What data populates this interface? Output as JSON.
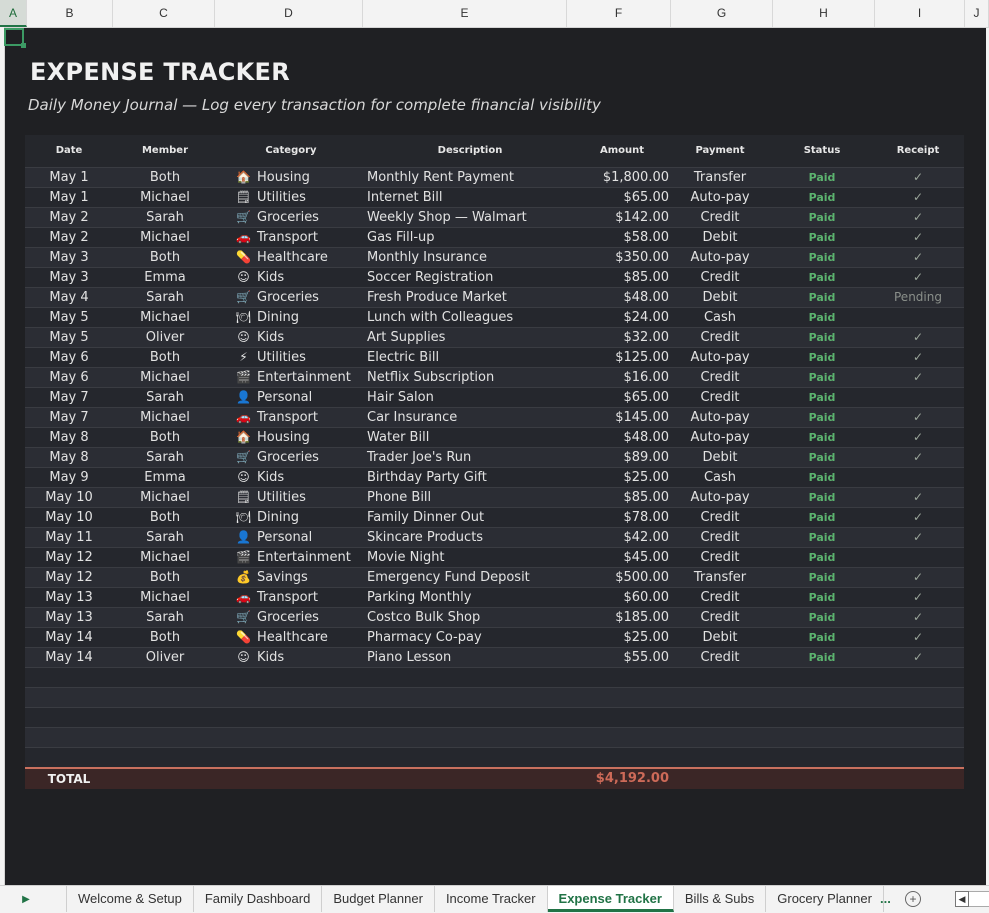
{
  "columns": [
    "A",
    "B",
    "C",
    "D",
    "E",
    "F",
    "G",
    "H",
    "I",
    "J"
  ],
  "title": "EXPENSE TRACKER",
  "subtitle": "Daily Money Journal — Log every transaction for complete financial visibility",
  "headers": {
    "date": "Date",
    "member": "Member",
    "category": "Category",
    "description": "Description",
    "amount": "Amount",
    "payment": "Payment",
    "status": "Status",
    "receipt": "Receipt"
  },
  "rows": [
    {
      "date": "May 1",
      "member": "Both",
      "icon": "house-icon",
      "glyph": "🏠",
      "category": "Housing",
      "description": "Monthly Rent Payment",
      "amount": "$1,800.00",
      "payment": "Transfer",
      "status": "Paid",
      "receipt": "✓"
    },
    {
      "date": "May 1",
      "member": "Michael",
      "icon": "bill-icon",
      "glyph": "🗒",
      "category": "Utilities",
      "description": "Internet Bill",
      "amount": "$65.00",
      "payment": "Auto-pay",
      "status": "Paid",
      "receipt": "✓"
    },
    {
      "date": "May 2",
      "member": "Sarah",
      "icon": "cart-icon",
      "glyph": "🛒",
      "category": "Groceries",
      "description": "Weekly Shop — Walmart",
      "amount": "$142.00",
      "payment": "Credit",
      "status": "Paid",
      "receipt": "✓"
    },
    {
      "date": "May 2",
      "member": "Michael",
      "icon": "car-icon",
      "glyph": "🚗",
      "category": "Transport",
      "description": "Gas Fill-up",
      "amount": "$58.00",
      "payment": "Debit",
      "status": "Paid",
      "receipt": "✓"
    },
    {
      "date": "May 3",
      "member": "Both",
      "icon": "pill-icon",
      "glyph": "💊",
      "category": "Healthcare",
      "description": "Monthly Insurance",
      "amount": "$350.00",
      "payment": "Auto-pay",
      "status": "Paid",
      "receipt": "✓"
    },
    {
      "date": "May 3",
      "member": "Emma",
      "icon": "baby-icon",
      "glyph": "☺",
      "category": "Kids",
      "description": "Soccer Registration",
      "amount": "$85.00",
      "payment": "Credit",
      "status": "Paid",
      "receipt": "✓"
    },
    {
      "date": "May 4",
      "member": "Sarah",
      "icon": "cart-icon",
      "glyph": "🛒",
      "category": "Groceries",
      "description": "Fresh Produce Market",
      "amount": "$48.00",
      "payment": "Debit",
      "status": "Paid",
      "receipt": "Pending"
    },
    {
      "date": "May 5",
      "member": "Michael",
      "icon": "plate-icon",
      "glyph": "🍽",
      "category": "Dining",
      "description": "Lunch with Colleagues",
      "amount": "$24.00",
      "payment": "Cash",
      "status": "Paid",
      "receipt": ""
    },
    {
      "date": "May 5",
      "member": "Oliver",
      "icon": "baby-icon",
      "glyph": "☺",
      "category": "Kids",
      "description": "Art Supplies",
      "amount": "$32.00",
      "payment": "Credit",
      "status": "Paid",
      "receipt": "✓"
    },
    {
      "date": "May 6",
      "member": "Both",
      "icon": "lightning-icon",
      "glyph": "⚡",
      "category": "Utilities",
      "description": "Electric Bill",
      "amount": "$125.00",
      "payment": "Auto-pay",
      "status": "Paid",
      "receipt": "✓"
    },
    {
      "date": "May 6",
      "member": "Michael",
      "icon": "clapper-icon",
      "glyph": "🎬",
      "category": "Entertainment",
      "description": "Netflix Subscription",
      "amount": "$16.00",
      "payment": "Credit",
      "status": "Paid",
      "receipt": "✓"
    },
    {
      "date": "May 7",
      "member": "Sarah",
      "icon": "person-icon",
      "glyph": "👤",
      "category": "Personal",
      "description": "Hair Salon",
      "amount": "$65.00",
      "payment": "Credit",
      "status": "Paid",
      "receipt": ""
    },
    {
      "date": "May 7",
      "member": "Michael",
      "icon": "car-icon",
      "glyph": "🚗",
      "category": "Transport",
      "description": "Car Insurance",
      "amount": "$145.00",
      "payment": "Auto-pay",
      "status": "Paid",
      "receipt": "✓"
    },
    {
      "date": "May 8",
      "member": "Both",
      "icon": "house-icon",
      "glyph": "🏠",
      "category": "Housing",
      "description": "Water Bill",
      "amount": "$48.00",
      "payment": "Auto-pay",
      "status": "Paid",
      "receipt": "✓"
    },
    {
      "date": "May 8",
      "member": "Sarah",
      "icon": "cart-icon",
      "glyph": "🛒",
      "category": "Groceries",
      "description": "Trader Joe's Run",
      "amount": "$89.00",
      "payment": "Debit",
      "status": "Paid",
      "receipt": "✓"
    },
    {
      "date": "May 9",
      "member": "Emma",
      "icon": "baby-icon",
      "glyph": "☺",
      "category": "Kids",
      "description": "Birthday Party Gift",
      "amount": "$25.00",
      "payment": "Cash",
      "status": "Paid",
      "receipt": ""
    },
    {
      "date": "May 10",
      "member": "Michael",
      "icon": "bill-icon",
      "glyph": "🗒",
      "category": "Utilities",
      "description": "Phone Bill",
      "amount": "$85.00",
      "payment": "Auto-pay",
      "status": "Paid",
      "receipt": "✓"
    },
    {
      "date": "May 10",
      "member": "Both",
      "icon": "plate-icon",
      "glyph": "🍽",
      "category": "Dining",
      "description": "Family Dinner Out",
      "amount": "$78.00",
      "payment": "Credit",
      "status": "Paid",
      "receipt": "✓"
    },
    {
      "date": "May 11",
      "member": "Sarah",
      "icon": "person-icon",
      "glyph": "👤",
      "category": "Personal",
      "description": "Skincare Products",
      "amount": "$42.00",
      "payment": "Credit",
      "status": "Paid",
      "receipt": "✓"
    },
    {
      "date": "May 12",
      "member": "Michael",
      "icon": "clapper-icon",
      "glyph": "🎬",
      "category": "Entertainment",
      "description": "Movie Night",
      "amount": "$45.00",
      "payment": "Credit",
      "status": "Paid",
      "receipt": ""
    },
    {
      "date": "May 12",
      "member": "Both",
      "icon": "money-bag-icon",
      "glyph": "💰",
      "category": "Savings",
      "description": "Emergency Fund Deposit",
      "amount": "$500.00",
      "payment": "Transfer",
      "status": "Paid",
      "receipt": "✓"
    },
    {
      "date": "May 13",
      "member": "Michael",
      "icon": "car-icon",
      "glyph": "🚗",
      "category": "Transport",
      "description": "Parking Monthly",
      "amount": "$60.00",
      "payment": "Credit",
      "status": "Paid",
      "receipt": "✓"
    },
    {
      "date": "May 13",
      "member": "Sarah",
      "icon": "cart-icon",
      "glyph": "🛒",
      "category": "Groceries",
      "description": "Costco Bulk Shop",
      "amount": "$185.00",
      "payment": "Credit",
      "status": "Paid",
      "receipt": "✓"
    },
    {
      "date": "May 14",
      "member": "Both",
      "icon": "pill-icon",
      "glyph": "💊",
      "category": "Healthcare",
      "description": "Pharmacy Co-pay",
      "amount": "$25.00",
      "payment": "Debit",
      "status": "Paid",
      "receipt": "✓"
    },
    {
      "date": "May 14",
      "member": "Oliver",
      "icon": "baby-icon",
      "glyph": "☺",
      "category": "Kids",
      "description": "Piano Lesson",
      "amount": "$55.00",
      "payment": "Credit",
      "status": "Paid",
      "receipt": "✓"
    }
  ],
  "total": {
    "label": "TOTAL",
    "amount": "$4,192.00"
  },
  "tabs": [
    "Welcome & Setup",
    "Family Dashboard",
    "Budget Planner",
    "Income Tracker",
    "Expense Tracker",
    "Bills & Subs",
    "Grocery Planner"
  ],
  "active_tab": "Expense Tracker",
  "colors": {
    "sheet_bg": "#1f2023",
    "paid": "#5cb36f",
    "total_amount": "#cd6a58",
    "excel_green": "#217346"
  }
}
